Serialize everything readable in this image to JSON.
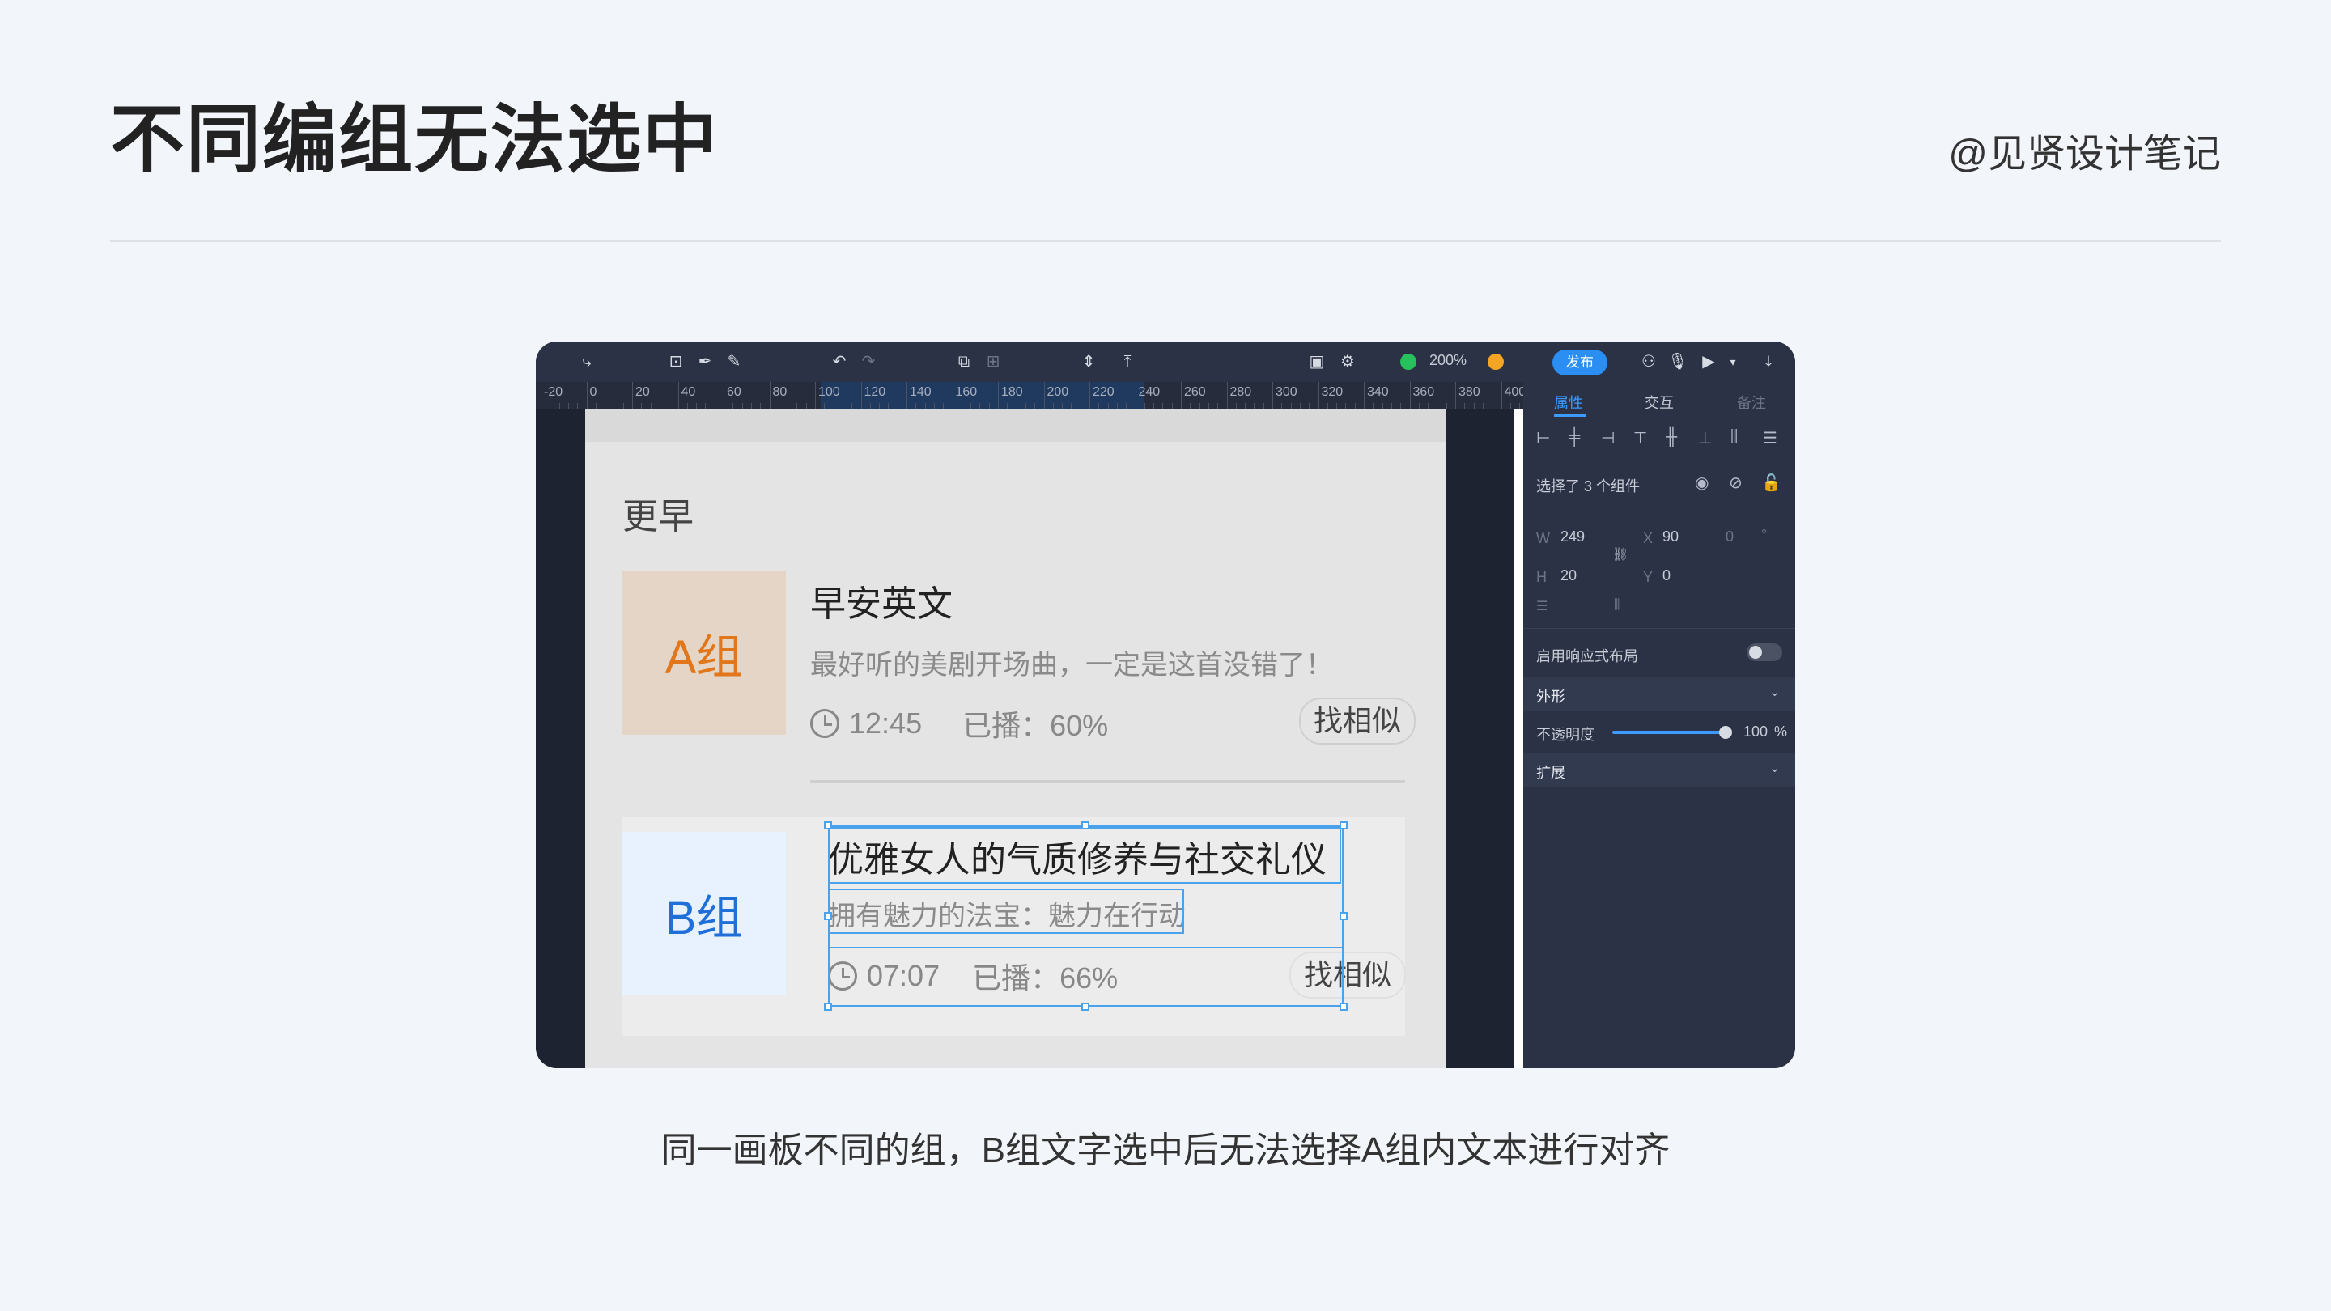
{
  "slide": {
    "title": "不同编组无法选中",
    "author": "@见贤设计笔记",
    "caption": "同一画板不同的组，B组文字选中后无法选择A组内文本进行对齐"
  },
  "toolbar": {
    "zoom": "200%",
    "publish": "发布",
    "icons": [
      "connector-icon",
      "artboard-icon",
      "pen-icon",
      "pencil-icon",
      "undo-icon",
      "redo-icon",
      "crop-icon",
      "slice-icon",
      "distribute-vertical-icon",
      "distribute-top-icon",
      "layers-icon",
      "settings-icon",
      "zoom-out-icon",
      "zoom-in-icon",
      "collaborator-icon",
      "mic-icon",
      "play-icon",
      "download-icon"
    ]
  },
  "ruler": {
    "ticks": [
      "-20",
      "0",
      "20",
      "40",
      "60",
      "80",
      "100",
      "120",
      "140",
      "160",
      "180",
      "200",
      "220",
      "240",
      "260",
      "280",
      "300",
      "320",
      "340",
      "360",
      "380",
      "400"
    ]
  },
  "artboard": {
    "section_title": "更早",
    "item_a": {
      "thumb": "A组",
      "title": "早安英文",
      "desc": "最好听的美剧开场曲，一定是这首没错了！",
      "time": "12:45",
      "played": "已播：60%",
      "button": "找相似"
    },
    "item_b": {
      "thumb": "B组",
      "title": "优雅女人的气质修养与社交礼仪",
      "desc": "拥有魅力的法宝：魅力在行动",
      "time": "07:07",
      "played": "已播：66%",
      "button": "找相似"
    }
  },
  "panel": {
    "tabs": [
      "属性",
      "交互",
      "备注"
    ],
    "selection": "选择了 3 个组件",
    "w_label": "W",
    "w_value": "249",
    "h_label": "H",
    "h_value": "20",
    "x_label": "X",
    "x_value": "90",
    "y_label": "Y",
    "y_value": "0",
    "rotation_value": "0",
    "rotation_unit": "°",
    "responsive": "启用响应式布局",
    "appearance": "外形",
    "opacity_label": "不透明度",
    "opacity_value": "100",
    "opacity_unit": "%",
    "opacity_level": 1.0,
    "expand": "扩展"
  }
}
